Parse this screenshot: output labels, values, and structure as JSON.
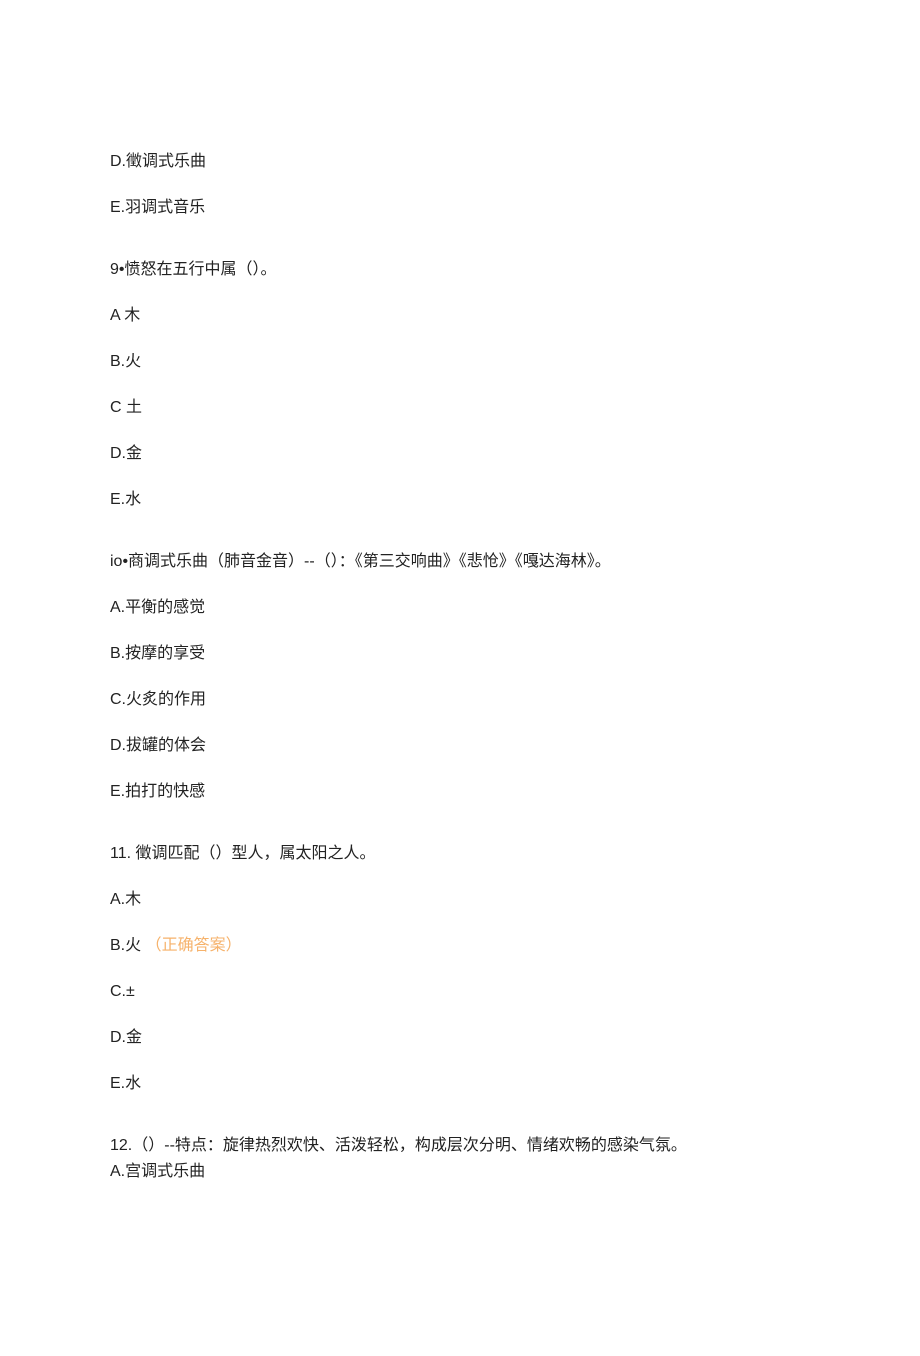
{
  "prev_tail": {
    "option_d": "D.徵调式乐曲",
    "option_e": "E.羽调式音乐"
  },
  "q9": {
    "stem": "9•愤怒在五行中属（）。",
    "a": "A 木",
    "b": "B.火",
    "c": "C 土",
    "d": "D.金",
    "e": "E.水"
  },
  "q10": {
    "stem": "io•商调式乐曲（肺音金音）--（）：《第三交响曲》《悲怆》《嘎达海林》。",
    "a": "A.平衡的感觉",
    "b": "B.按摩的享受",
    "c": "C.火炙的作用",
    "d": "D.拔罐的体会",
    "e": "E.拍打的快感"
  },
  "q11": {
    "stem": "11. 徵调匹配（）型人，属太阳之人。",
    "a": "A.木",
    "b_prefix": "B.火",
    "b_correct": "（正确答案）",
    "c": "C.±",
    "d": "D.金",
    "e": "E.水"
  },
  "q12": {
    "stem": "12.（）--特点：旋律热烈欢快、活泼轻松，构成层次分明、情绪欢畅的感染气氛。",
    "a": "A.宫调式乐曲"
  }
}
